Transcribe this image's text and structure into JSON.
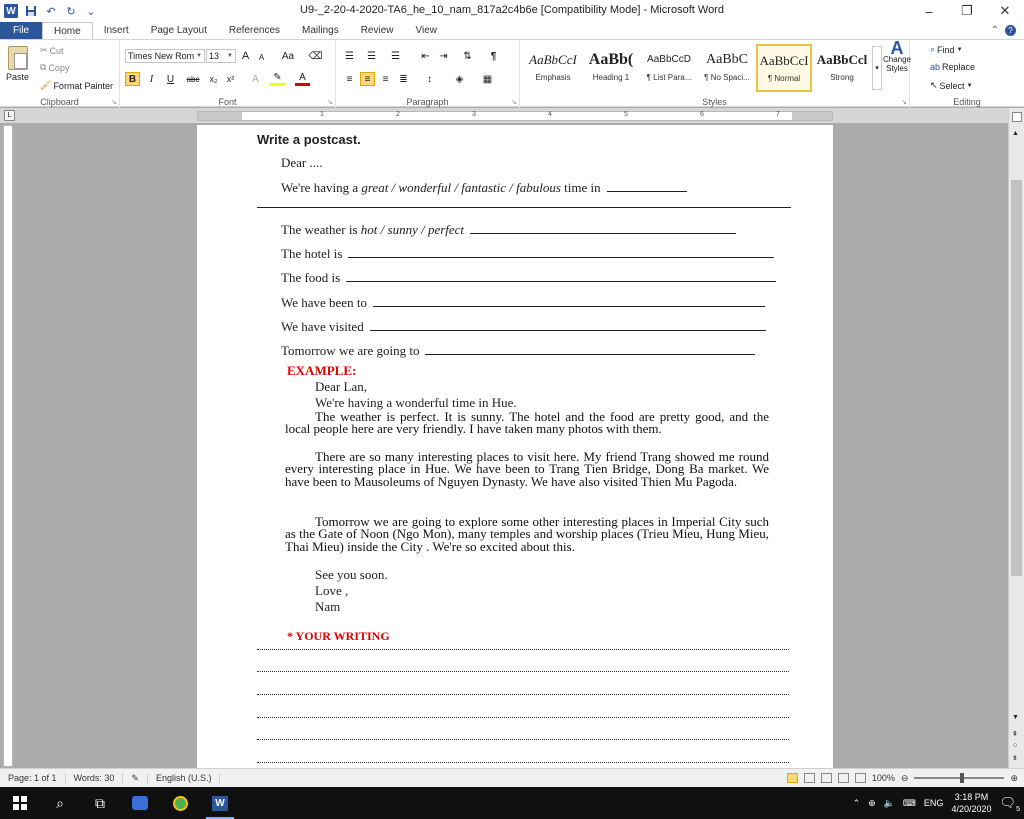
{
  "window": {
    "title": "U9-_2-20-4-2020-TA6_he_10_nam_817a2c4b6e [Compatibility Mode] - Microsoft Word",
    "minimize": "–",
    "restore": "❐",
    "close": "✕"
  },
  "tabs": [
    {
      "label": "File"
    },
    {
      "label": "Home"
    },
    {
      "label": "Insert"
    },
    {
      "label": "Page Layout"
    },
    {
      "label": "References"
    },
    {
      "label": "Mailings"
    },
    {
      "label": "Review"
    },
    {
      "label": "View"
    }
  ],
  "ribbon": {
    "clipboard": {
      "paste": "Paste",
      "cut": "Cut",
      "copy": "Copy",
      "format_painter": "Format Painter",
      "label": "Clipboard"
    },
    "font": {
      "name": "Times New Rom",
      "size": "13",
      "bold": "B",
      "italic": "I",
      "underline": "U",
      "strike": "abc",
      "subscript": "x₂",
      "superscript": "x²",
      "grow": "A",
      "shrink": "A",
      "case": "Aa",
      "label": "Font"
    },
    "paragraph": {
      "label": "Paragraph",
      "pilcrow": "¶"
    },
    "styles": {
      "label": "Styles",
      "items": [
        {
          "sample": "AaBbCcI",
          "name": "Emphasis"
        },
        {
          "sample": "AaBb(",
          "name": "Heading 1"
        },
        {
          "sample": "AaBbCcD",
          "name": "¶ List Para..."
        },
        {
          "sample": "AaBbC",
          "name": "¶ No Spaci..."
        },
        {
          "sample": "AaBbCcI",
          "name": "¶ Normal"
        },
        {
          "sample": "AaBbCcl",
          "name": "Strong"
        }
      ],
      "change_styles": "Change Styles"
    },
    "editing": {
      "find": "Find",
      "replace": "Replace",
      "select": "Select",
      "label": "Editing"
    }
  },
  "document": {
    "heading": "Write a postcast.",
    "template": {
      "dear": "Dear ....",
      "having_prefix": "We're having a",
      "having_options": "great / wonderful / fantastic / fabulous",
      "having_suffix": "time in",
      "weather_prefix": "The weather is",
      "weather_options": "hot / sunny / perfect",
      "hotel": "The hotel is",
      "food": "The food is",
      "been_to": "We have been to",
      "visited": "We have visited",
      "tomorrow": "Tomorrow we are going to"
    },
    "example": {
      "label": "EXAMPLE:",
      "greeting": "Dear Lan,",
      "line1": "We're having a  wonderful time in Hue.",
      "para1": "The weather is  perfect. It is sunny. The hotel and the food are pretty good, and the local people here are very friendly. I have taken many photos with them.",
      "para2": "There are so many interesting places to visit here. My friend Trang showed me round every interesting place in Hue. We have been to Trang Tien Bridge, Dong Ba market. We have been to Mausoleums of Nguyen Dynasty. We have also visited Thien Mu Pagoda.",
      "para3": "Tomorrow we are going to explore some other interesting places in Imperial City such as the Gate of Noon (Ngo Mon), many temples and worship places (Trieu Mieu, Hung Mieu, Thai Mieu) inside the City . We're so excited about this.",
      "closing1": "See you soon.",
      "closing2": "Love ,",
      "signature": "Nam"
    },
    "writing_label": "* YOUR WRITING"
  },
  "status": {
    "page": "Page: 1 of 1",
    "words": "Words: 30",
    "language": "English (U.S.)",
    "zoom": "100%"
  },
  "taskbar": {
    "language": "ENG",
    "time": "3:18 PM",
    "date": "4/20/2020",
    "notification_count": "5"
  }
}
